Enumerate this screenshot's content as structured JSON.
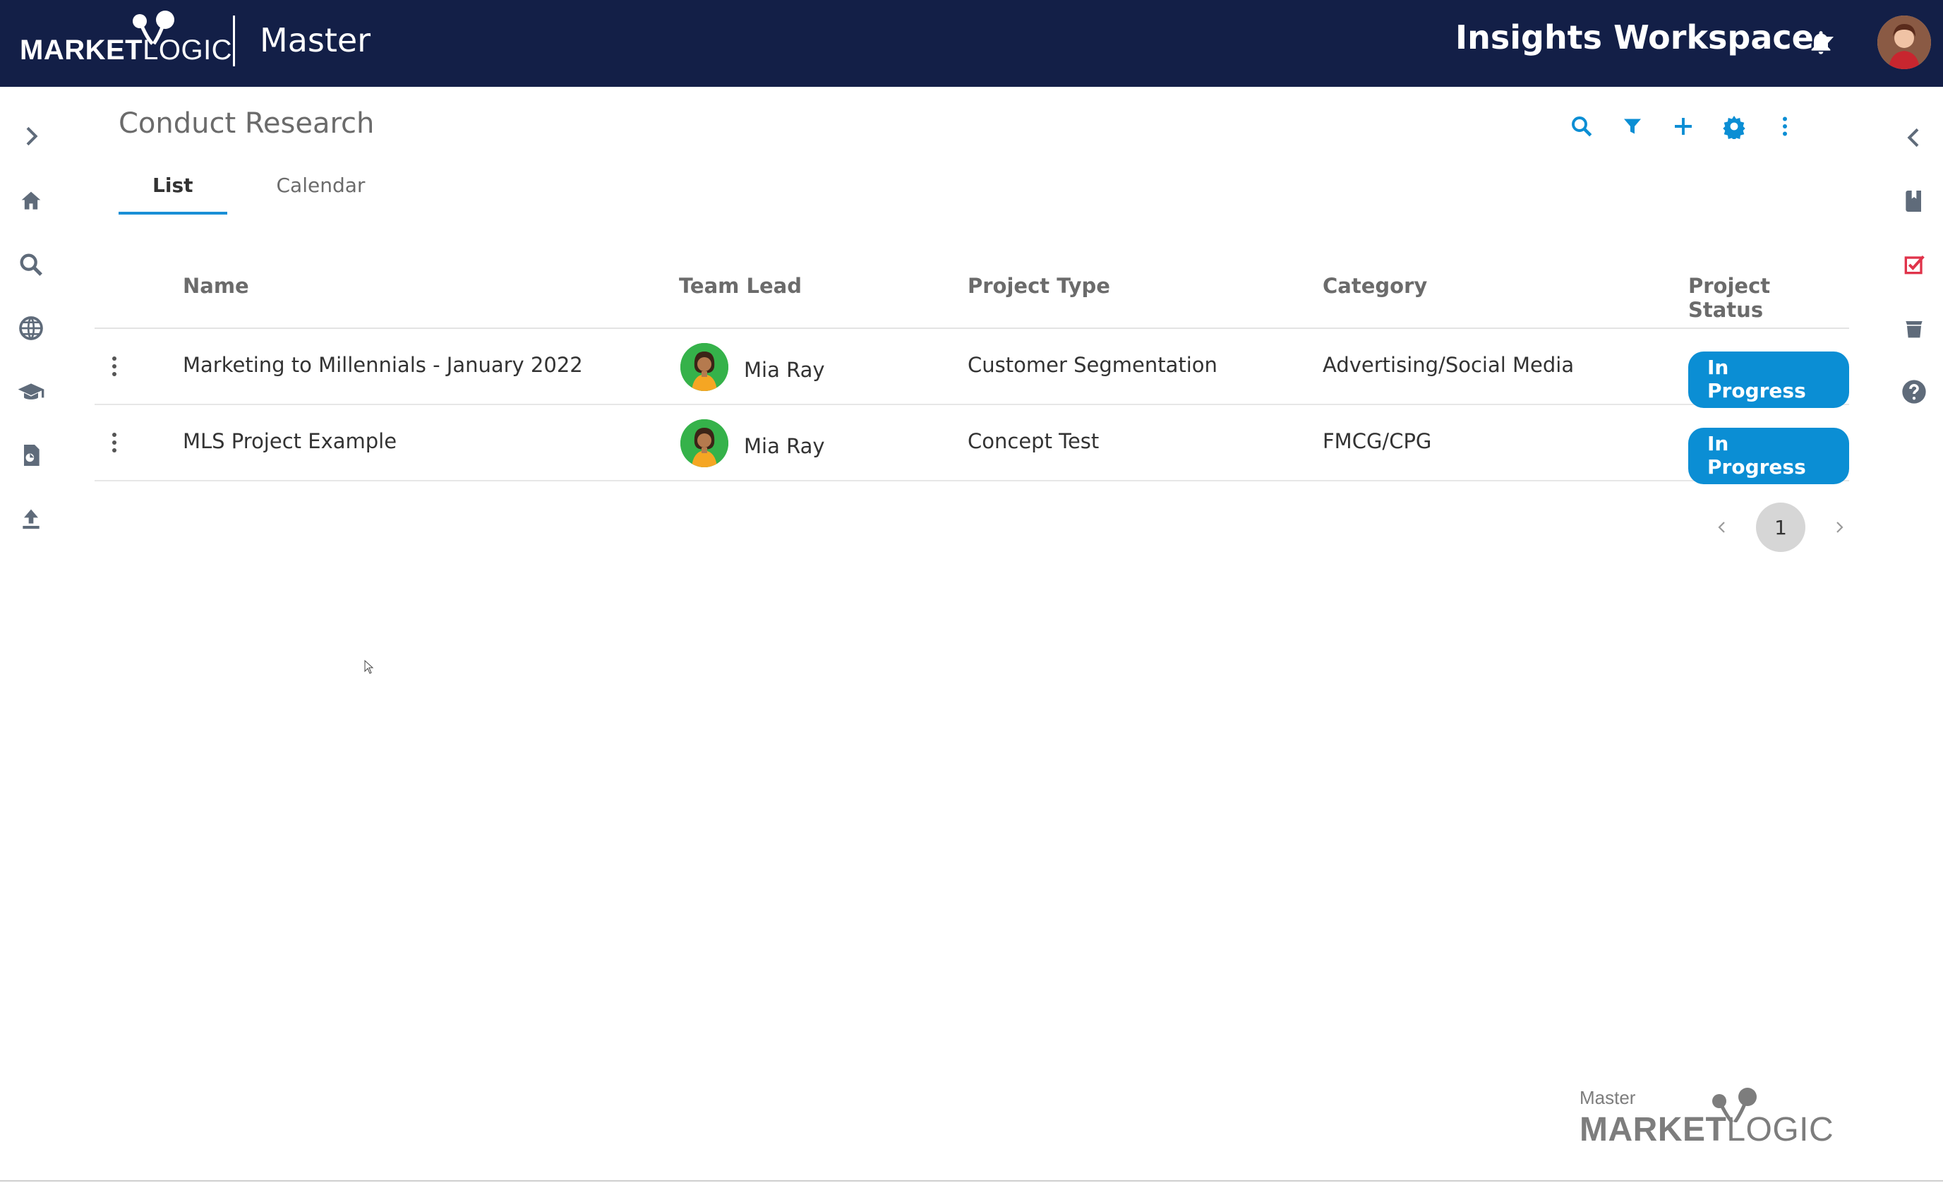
{
  "header": {
    "logo_bold": "MARKET",
    "logo_light": "LOGIC",
    "app_title": "Master",
    "workspace": "Insights Workspace"
  },
  "page": {
    "title": "Conduct Research",
    "tabs": [
      {
        "label": "List",
        "active": true
      },
      {
        "label": "Calendar",
        "active": false
      }
    ]
  },
  "toolbar": {
    "icons": [
      "search-icon",
      "filter-icon",
      "plus-icon",
      "gear-icon",
      "more-vertical-icon"
    ]
  },
  "left_rail": {
    "icons": [
      "chevron-right-icon",
      "home-icon",
      "search-icon",
      "globe-icon",
      "graduation-cap-icon",
      "report-icon",
      "upload-icon"
    ]
  },
  "right_rail": {
    "icons": [
      "chevron-left-icon",
      "bookmark-book-icon",
      "checklist-icon",
      "stack-icon",
      "help-icon"
    ]
  },
  "table": {
    "columns": [
      "Name",
      "Team Lead",
      "Project Type",
      "Category",
      "Project Status"
    ],
    "rows": [
      {
        "name": "Marketing to Millennials - January 2022",
        "lead": "Mia Ray",
        "type": "Customer Segmentation",
        "category": "Advertising/Social Media",
        "status": "In Progress"
      },
      {
        "name": "MLS Project Example",
        "lead": "Mia Ray",
        "type": "Concept Test",
        "category": "FMCG/CPG",
        "status": "In Progress"
      }
    ]
  },
  "pagination": {
    "current": "1"
  },
  "footer": {
    "master": "Master",
    "logo_bold": "MARKET",
    "logo_light": "LOGIC"
  },
  "colors": {
    "header_bg": "#131f47",
    "accent": "#0b8ed4",
    "tab_underline": "#1a8fd6",
    "red_icon": "#e0334a"
  }
}
